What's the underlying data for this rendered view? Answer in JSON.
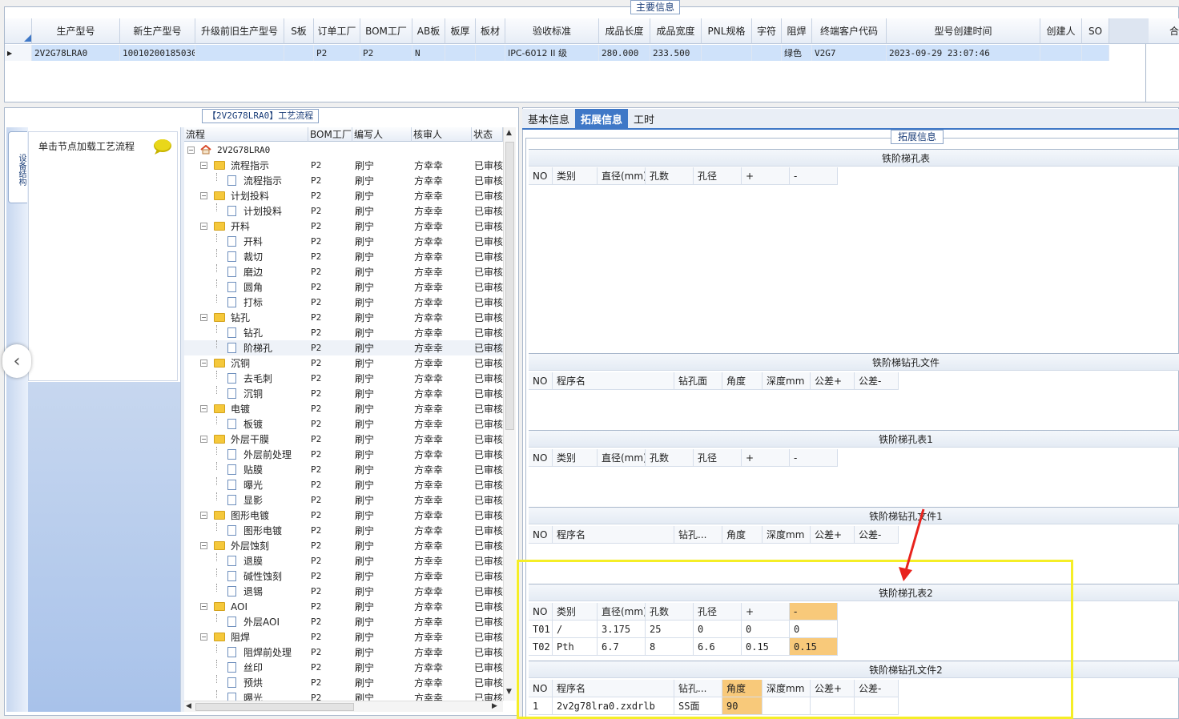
{
  "top": {
    "title": "主要信息",
    "columns": [
      "生产型号",
      "新生产型号",
      "升级前旧生产型号",
      "S板",
      "订单工厂",
      "BOM工厂",
      "AB板",
      "板厚",
      "板材",
      "验收标准",
      "成品长度",
      "成品宽度",
      "PNL规格",
      "字符",
      "阻焊",
      "终端客户代码",
      "型号创建时间",
      "创建人",
      "SO"
    ],
    "row": [
      "2V2G78LRA0",
      "10010200185030",
      "",
      "",
      "P2",
      "P2",
      "N",
      "",
      "",
      "IPC-6012 II 级",
      "280.000",
      "233.500",
      "",
      "",
      "绿色",
      "V2G7",
      "2023-09-29 23:07:46",
      "",
      ""
    ],
    "right_header": "合"
  },
  "left": {
    "title": "【2V2G78LRA0】工艺流程",
    "side_tab": "设备结构",
    "node_load_label": "单击节点加载工艺流程",
    "tree_headers": [
      "流程",
      "BOM工厂",
      "编写人",
      "核审人",
      "状态"
    ],
    "root": "2V2G78LRA0",
    "rows": [
      {
        "name": "流程指示",
        "level": 1,
        "bom": "P2",
        "writer": "刷宁",
        "checker": "方幸幸",
        "status": "已审核"
      },
      {
        "name": "流程指示",
        "level": 2,
        "bom": "P2",
        "writer": "刷宁",
        "checker": "方幸幸",
        "status": "已审核"
      },
      {
        "name": "计划投料",
        "level": 1,
        "bom": "P2",
        "writer": "刷宁",
        "checker": "方幸幸",
        "status": "已审核"
      },
      {
        "name": "计划投料",
        "level": 2,
        "bom": "P2",
        "writer": "刷宁",
        "checker": "方幸幸",
        "status": "已审核"
      },
      {
        "name": "开料",
        "level": 1,
        "bom": "P2",
        "writer": "刷宁",
        "checker": "方幸幸",
        "status": "已审核"
      },
      {
        "name": "开料",
        "level": 2,
        "bom": "P2",
        "writer": "刷宁",
        "checker": "方幸幸",
        "status": "已审核"
      },
      {
        "name": "裁切",
        "level": 2,
        "bom": "P2",
        "writer": "刷宁",
        "checker": "方幸幸",
        "status": "已审核"
      },
      {
        "name": "磨边",
        "level": 2,
        "bom": "P2",
        "writer": "刷宁",
        "checker": "方幸幸",
        "status": "已审核"
      },
      {
        "name": "圆角",
        "level": 2,
        "bom": "P2",
        "writer": "刷宁",
        "checker": "方幸幸",
        "status": "已审核"
      },
      {
        "name": "打标",
        "level": 2,
        "bom": "P2",
        "writer": "刷宁",
        "checker": "方幸幸",
        "status": "已审核"
      },
      {
        "name": "钻孔",
        "level": 1,
        "bom": "P2",
        "writer": "刷宁",
        "checker": "方幸幸",
        "status": "已审核"
      },
      {
        "name": "钻孔",
        "level": 2,
        "bom": "P2",
        "writer": "刷宁",
        "checker": "方幸幸",
        "status": "已审核"
      },
      {
        "name": "阶梯孔",
        "level": 2,
        "bom": "P2",
        "writer": "刷宁",
        "checker": "方幸幸",
        "status": "已审核",
        "selected": true
      },
      {
        "name": "沉铜",
        "level": 1,
        "bom": "P2",
        "writer": "刷宁",
        "checker": "方幸幸",
        "status": "已审核"
      },
      {
        "name": "去毛刺",
        "level": 2,
        "bom": "P2",
        "writer": "刷宁",
        "checker": "方幸幸",
        "status": "已审核"
      },
      {
        "name": "沉铜",
        "level": 2,
        "bom": "P2",
        "writer": "刷宁",
        "checker": "方幸幸",
        "status": "已审核"
      },
      {
        "name": "电镀",
        "level": 1,
        "bom": "P2",
        "writer": "刷宁",
        "checker": "方幸幸",
        "status": "已审核"
      },
      {
        "name": "板镀",
        "level": 2,
        "bom": "P2",
        "writer": "刷宁",
        "checker": "方幸幸",
        "status": "已审核"
      },
      {
        "name": "外层干膜",
        "level": 1,
        "bom": "P2",
        "writer": "刷宁",
        "checker": "方幸幸",
        "status": "已审核"
      },
      {
        "name": "外层前处理",
        "level": 2,
        "bom": "P2",
        "writer": "刷宁",
        "checker": "方幸幸",
        "status": "已审核"
      },
      {
        "name": "贴膜",
        "level": 2,
        "bom": "P2",
        "writer": "刷宁",
        "checker": "方幸幸",
        "status": "已审核"
      },
      {
        "name": "曝光",
        "level": 2,
        "bom": "P2",
        "writer": "刷宁",
        "checker": "方幸幸",
        "status": "已审核"
      },
      {
        "name": "显影",
        "level": 2,
        "bom": "P2",
        "writer": "刷宁",
        "checker": "方幸幸",
        "status": "已审核"
      },
      {
        "name": "图形电镀",
        "level": 1,
        "bom": "P2",
        "writer": "刷宁",
        "checker": "方幸幸",
        "status": "已审核"
      },
      {
        "name": "图形电镀",
        "level": 2,
        "bom": "P2",
        "writer": "刷宁",
        "checker": "方幸幸",
        "status": "已审核"
      },
      {
        "name": "外层蚀刻",
        "level": 1,
        "bom": "P2",
        "writer": "刷宁",
        "checker": "方幸幸",
        "status": "已审核"
      },
      {
        "name": "退膜",
        "level": 2,
        "bom": "P2",
        "writer": "刷宁",
        "checker": "方幸幸",
        "status": "已审核"
      },
      {
        "name": "碱性蚀刻",
        "level": 2,
        "bom": "P2",
        "writer": "刷宁",
        "checker": "方幸幸",
        "status": "已审核"
      },
      {
        "name": "退锡",
        "level": 2,
        "bom": "P2",
        "writer": "刷宁",
        "checker": "方幸幸",
        "status": "已审核"
      },
      {
        "name": "AOI",
        "level": 1,
        "bom": "P2",
        "writer": "刷宁",
        "checker": "方幸幸",
        "status": "已审核"
      },
      {
        "name": "外层AOI",
        "level": 2,
        "bom": "P2",
        "writer": "刷宁",
        "checker": "方幸幸",
        "status": "已审核"
      },
      {
        "name": "阻焊",
        "level": 1,
        "bom": "P2",
        "writer": "刷宁",
        "checker": "方幸幸",
        "status": "已审核"
      },
      {
        "name": "阻焊前处理",
        "level": 2,
        "bom": "P2",
        "writer": "刷宁",
        "checker": "方幸幸",
        "status": "已审核"
      },
      {
        "name": "丝印",
        "level": 2,
        "bom": "P2",
        "writer": "刷宁",
        "checker": "方幸幸",
        "status": "已审核"
      },
      {
        "name": "预烘",
        "level": 2,
        "bom": "P2",
        "writer": "刷宁",
        "checker": "方幸幸",
        "status": "已审核"
      },
      {
        "name": "曝光",
        "level": 2,
        "bom": "P2",
        "writer": "刷宁",
        "checker": "方幸幸",
        "status": "已审核"
      }
    ]
  },
  "right": {
    "tabs": [
      "基本信息",
      "拓展信息",
      "工时"
    ],
    "active_tab": 1,
    "ext_title": "拓展信息",
    "sections": {
      "hole1": {
        "title": "铁阶梯孔表",
        "headers": [
          "NO",
          "类别",
          "直径(mm)",
          "孔数",
          "孔径",
          "+",
          "-"
        ]
      },
      "drill1": {
        "title": "铁阶梯钻孔文件",
        "headers": [
          "NO",
          "程序名",
          "钻孔面",
          "角度",
          "深度mm",
          "公差+",
          "公差-"
        ]
      },
      "hole2": {
        "title": "铁阶梯孔表1",
        "headers": [
          "NO",
          "类别",
          "直径(mm)",
          "孔数",
          "孔径",
          "+",
          "-"
        ]
      },
      "drill2": {
        "title": "铁阶梯钻孔文件1",
        "headers": [
          "NO",
          "程序名",
          "钻孔...",
          "角度",
          "深度mm",
          "公差+",
          "公差-"
        ]
      },
      "hole3": {
        "title": "铁阶梯孔表2",
        "headers": [
          "NO",
          "类别",
          "直径(mm)",
          "孔数",
          "孔径",
          "+",
          "-"
        ],
        "rows": [
          [
            "T01",
            "/",
            "3.175",
            "25",
            "0",
            "0",
            "0"
          ],
          [
            "T02",
            "Pth",
            "6.7",
            "8",
            "6.6",
            "0.15",
            "0.15"
          ]
        ]
      },
      "drill3": {
        "title": "铁阶梯钻孔文件2",
        "headers": [
          "NO",
          "程序名",
          "钻孔...",
          "角度",
          "深度mm",
          "公差+",
          "公差-"
        ],
        "rows": [
          [
            "1",
            "2v2g78lra0.zxdrlb",
            "SS面",
            "90",
            "",
            "",
            ""
          ]
        ]
      }
    }
  },
  "colors": {
    "accent": "#3f78c7",
    "selection": "#cfe2fa",
    "highlight": "#f8c97a",
    "annotation_box": "#f5ee27",
    "annotation_arrow": "#e8231d"
  }
}
